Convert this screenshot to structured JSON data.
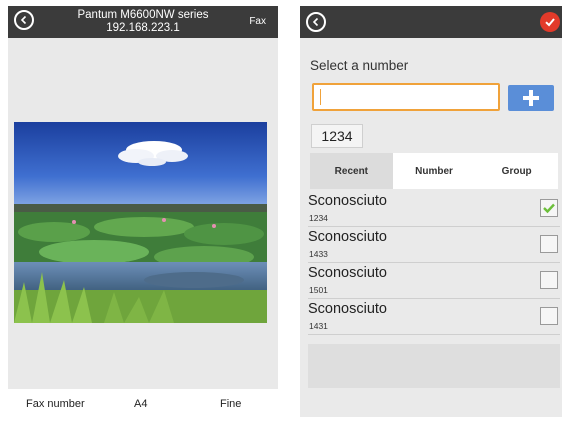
{
  "left": {
    "title_line1": "Pantum M6600NW series",
    "title_line2": "192.168.223.1",
    "mode_label": "Fax",
    "footer": {
      "fax_number": "Fax number",
      "paper_size": "A4",
      "quality": "Fine"
    }
  },
  "right": {
    "select_label": "Select a number",
    "input_value": "",
    "selected_chip": "1234",
    "tabs": [
      {
        "label": "Recent",
        "active": true
      },
      {
        "label": "Number",
        "active": false
      },
      {
        "label": "Group",
        "active": false
      }
    ],
    "contacts": [
      {
        "name": "Sconosciuto",
        "number": "1234",
        "checked": true
      },
      {
        "name": "Sconosciuto",
        "number": "1433",
        "checked": false
      },
      {
        "name": "Sconosciuto",
        "number": "1501",
        "checked": false
      },
      {
        "name": "Sconosciuto",
        "number": "1431",
        "checked": false
      }
    ]
  },
  "colors": {
    "header": "#3b3b3b",
    "accent_orange": "#f0a23a",
    "add_button": "#5a8ed8",
    "confirm_red": "#e23a2a",
    "check_green": "#6cbf3a"
  },
  "icons": {
    "back": "back-arrow-icon",
    "confirm": "checkmark-icon",
    "add": "plus-icon",
    "check": "checkmark-icon"
  }
}
